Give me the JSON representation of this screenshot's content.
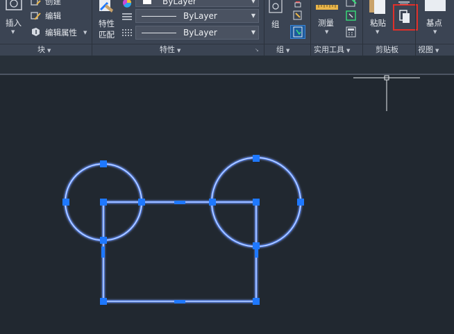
{
  "ribbon": {
    "block": {
      "insert_label": "插入",
      "create_label": "创建",
      "edit_label": "编辑",
      "edit_attr_label": "编辑属性",
      "panel_title": "块"
    },
    "properties": {
      "match_label_1": "特性",
      "match_label_2": "匹配",
      "color_value": "ByLayer",
      "linetype_value": "ByLayer",
      "lineweight_value": "ByLayer",
      "panel_title": "特性"
    },
    "groups": {
      "group_label": "组",
      "panel_title": "组"
    },
    "utilities": {
      "measure_label": "测量",
      "panel_title": "实用工具"
    },
    "clipboard": {
      "paste_label": "粘贴",
      "panel_title": "剪贴板"
    },
    "view": {
      "basepoint_label": "基点",
      "panel_title": "视图"
    },
    "dropdown_glyph": "▼",
    "expand_glyph": "↘"
  },
  "colors": {
    "ribbon_bg": "#3b4453",
    "canvas_bg": "#212830",
    "highlight_box": "#e0302a",
    "grip": "#1e78ff",
    "selected_line": "#dbe6ff",
    "selected_glow": "#3f7bff"
  }
}
